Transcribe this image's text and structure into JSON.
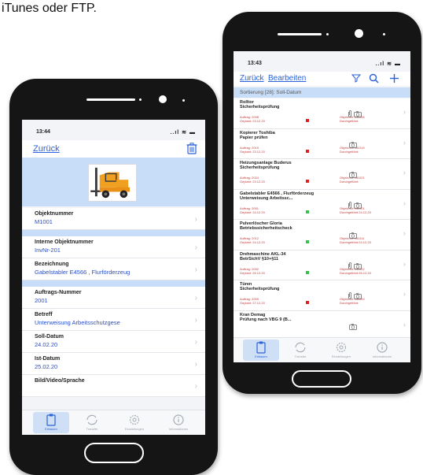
{
  "caption": "iTunes oder FTP.",
  "left_phone": {
    "status": {
      "time": "13:44",
      "signal": "..ıl ≋ ▬"
    },
    "nav": {
      "back_label": "Zurück"
    },
    "fields": [
      {
        "label": "Objektnummer",
        "value": "M1001"
      },
      {
        "label": "Interne Objektnummer",
        "value": "InvNr-201"
      },
      {
        "label": "Bezeichnung",
        "value": "Gabelstabler E4566 , Flurförderzeug"
      },
      {
        "label": "Auftrags-Nummer",
        "value": "2001"
      },
      {
        "label": "Betreff",
        "value": "Unterweisung Arbeitsschutzgese"
      },
      {
        "label": "Soll-Datum",
        "value": "24.02.20"
      },
      {
        "label": "Ist-Datum",
        "value": "25.02.20"
      },
      {
        "label": "Bild/Video/Sprache",
        "value": ""
      }
    ],
    "tabs": [
      "Erfassen",
      "Transfer",
      "Einstellungen",
      "Informationen"
    ]
  },
  "right_phone": {
    "status": {
      "time": "13:43",
      "signal": "..ıl ≋ ▬"
    },
    "nav": {
      "back_label": "Zurück",
      "edit_label": "Bearbeiten"
    },
    "sort_label": "Sortierung [28]: Soll-Datum",
    "rows": [
      {
        "t1": "Rolltor",
        "t2": "Sicherheitsprüfung",
        "m1": "Auftrag: 2008",
        "m2": "Geplant: 23.12.20",
        "o1": "Objekt-Nr: M1008",
        "o2": "Durchgeführt:",
        "status": "#e02020",
        "clip": true
      },
      {
        "t1": "Kopierer Toshiba",
        "t2": "Papier prüfen",
        "m1": "Auftrag: 2019",
        "m2": "Geplant: 23.12.20",
        "o1": "Objekt-Nr: M1019",
        "o2": "Durchgeführt:",
        "status": "#e02020",
        "clip": false
      },
      {
        "t1": "Heizungsanlage Buderus",
        "t2": "Sicherheitsprüfung",
        "m1": "Auftrag: 2024",
        "m2": "Geplant: 23.12.20",
        "o1": "Objekt-Nr: M1021",
        "o2": "Durchgeführt:",
        "status": "#e02020",
        "clip": false
      },
      {
        "t1": "Gabelstabler E4566 , Flurförderzeug",
        "t2": "Unterweisung Arbeitssc...",
        "m1": "Auftrag: 2001",
        "m2": "Geplant: 24.12.20",
        "o1": "Objekt-Nr: M1001",
        "o2": "Durchgeführt:24.12.20",
        "status": "#36c24a",
        "clip": true
      },
      {
        "t1": "Pulverlöscher Gloria",
        "t2": "Betriebssicherheitscheck",
        "m1": "Auftrag: 2012",
        "m2": "Geplant: 24.12.20",
        "o1": "Objekt-Nr: M1011",
        "o2": "Durchgeführt:24.12.20",
        "status": "#36c24a",
        "clip": false
      },
      {
        "t1": "Drehmaschine AKL-34",
        "t2": "BetrSichV §10+§11",
        "m1": "Auftrag: 2002",
        "m2": "Geplant: 26.12.20",
        "o1": "Objekt-Nr: M1002",
        "o2": "Durchgeführt:26.12.20",
        "status": "#36c24a",
        "clip": true
      },
      {
        "t1": "Türen",
        "t2": "Sicherheitsprüfung",
        "m1": "Auftrag: 2009",
        "m2": "Geplant: 27.12.20",
        "o1": "Objekt-Nr: M1009",
        "o2": "Durchgeführt:",
        "status": "#e02020",
        "clip": true
      },
      {
        "t1": "Kran Demag",
        "t2": "Prüfung nach VBG 9 (B...",
        "m1": "",
        "m2": "",
        "o1": "",
        "o2": "",
        "status": "",
        "clip": false
      }
    ],
    "tabs": [
      "Erfassen",
      "Transfer",
      "Einstellungen",
      "Informationen"
    ]
  },
  "colors": {
    "accent": "#2a62d8",
    "highlight": "#c8ddf7",
    "overdue": "#e02020",
    "done": "#36c24a"
  }
}
